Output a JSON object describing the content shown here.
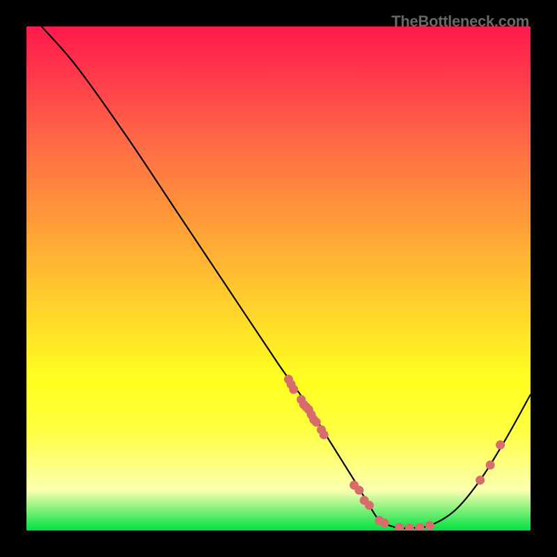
{
  "watermark": "TheBottleneck.com",
  "chart_data": {
    "type": "line",
    "title": "",
    "xlabel": "",
    "ylabel": "",
    "xlim": [
      0,
      100
    ],
    "ylim": [
      0,
      100
    ],
    "curve": {
      "name": "bottleneck-curve",
      "x": [
        3,
        10,
        20,
        30,
        40,
        50,
        55,
        60,
        65,
        68,
        70,
        72,
        74,
        76,
        80,
        85,
        90,
        95,
        100
      ],
      "y": [
        100,
        92,
        78,
        63,
        48,
        33,
        26,
        18,
        10,
        5,
        2,
        1,
        0.5,
        0.5,
        1,
        4,
        10,
        18,
        27
      ]
    },
    "points": {
      "name": "data-markers",
      "color": "#d86b6b",
      "x": [
        52,
        52.5,
        53,
        54.5,
        55,
        55.5,
        56,
        56.5,
        57,
        57.5,
        58.5,
        59,
        65,
        66,
        67,
        68,
        70,
        71,
        74,
        76,
        78,
        80,
        90,
        92,
        94
      ],
      "y": [
        30,
        29,
        28,
        26,
        25,
        24.5,
        24,
        23,
        22,
        21.5,
        20,
        19,
        9,
        8,
        6,
        5,
        2,
        1.5,
        0.6,
        0.5,
        0.6,
        1,
        10,
        13,
        17
      ]
    }
  }
}
